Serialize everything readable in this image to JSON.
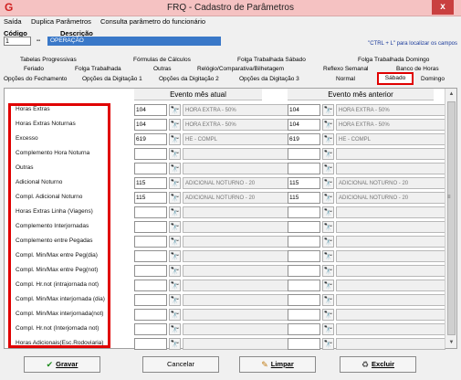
{
  "window": {
    "title": "FRQ - Cadastro de Parâmetros",
    "close": "x"
  },
  "menu": [
    "Saída",
    "Duplica Parâmetros",
    "Consulta parâmetro do funcionário"
  ],
  "fields": {
    "code_label": "Código",
    "desc_label": "Descrição",
    "code_value": "1",
    "desc_value": "OPERAÇÃO",
    "hint": "\"CTRL + L\" para localizar os campos"
  },
  "tabs": {
    "row1": [
      "Tabelas Progressivas",
      "Fórmulas de Cálculos",
      "Folga Trabalhada Sábado",
      "Folga Trabalhada Domingo"
    ],
    "row2": [
      "Feriado",
      "Folga Trabalhada",
      "Outras",
      "Relógio/Comparativa/Bilhetagem",
      "Reflexo Semanal",
      "Banco de Horas"
    ],
    "row3": [
      "Opções do Fechamento",
      "Opções da Digitação 1",
      "Opções da Digitação 2",
      "Opções da Digitação 3",
      "Normal",
      "Sábado",
      "Domingo"
    ],
    "selected": "Sábado"
  },
  "panel": {
    "header_current": "Evento mês atual",
    "header_previous": "Evento mês anterior",
    "rows": [
      {
        "label": "Horas Extras",
        "cur_code": "104",
        "cur_desc": "HORA EXTRA - 50%",
        "prev_code": "104",
        "prev_desc": "HORA EXTRA - 50%"
      },
      {
        "label": "Horas Extras Noturnas",
        "cur_code": "104",
        "cur_desc": "HORA EXTRA - 50%",
        "prev_code": "104",
        "prev_desc": "HORA EXTRA - 50%"
      },
      {
        "label": "Excesso",
        "cur_code": "619",
        "cur_desc": "HE - COMPL",
        "prev_code": "619",
        "prev_desc": "HE - COMPL"
      },
      {
        "label": "Complemento Hora Noturna",
        "cur_code": "",
        "cur_desc": "",
        "prev_code": "",
        "prev_desc": ""
      },
      {
        "label": "Outras",
        "cur_code": "",
        "cur_desc": "",
        "prev_code": "",
        "prev_desc": ""
      },
      {
        "label": "Adicional Noturno",
        "cur_code": "115",
        "cur_desc": "ADICIONAL NOTURNO - 20",
        "prev_code": "115",
        "prev_desc": "ADICIONAL NOTURNO - 20"
      },
      {
        "label": "Compl. Adicional Noturno",
        "cur_code": "115",
        "cur_desc": "ADICIONAL NOTURNO - 20",
        "prev_code": "115",
        "prev_desc": "ADICIONAL NOTURNO - 20"
      },
      {
        "label": "Horas Extras Linha (Viagens)",
        "cur_code": "",
        "cur_desc": "",
        "prev_code": "",
        "prev_desc": ""
      },
      {
        "label": "Complemento Interjornadas",
        "cur_code": "",
        "cur_desc": "",
        "prev_code": "",
        "prev_desc": ""
      },
      {
        "label": "Complemento entre Pegadas",
        "cur_code": "",
        "cur_desc": "",
        "prev_code": "",
        "prev_desc": ""
      },
      {
        "label": "Compl. Min/Max entre Peg(dia)",
        "cur_code": "",
        "cur_desc": "",
        "prev_code": "",
        "prev_desc": ""
      },
      {
        "label": "Compl. Min/Max entre Peg(not)",
        "cur_code": "",
        "cur_desc": "",
        "prev_code": "",
        "prev_desc": ""
      },
      {
        "label": "Compl. Hr.not (intrajornada not)",
        "cur_code": "",
        "cur_desc": "",
        "prev_code": "",
        "prev_desc": ""
      },
      {
        "label": "Compl. Min/Max interjornada (dia)",
        "cur_code": "",
        "cur_desc": "",
        "prev_code": "",
        "prev_desc": ""
      },
      {
        "label": "Compl. Min/Max interjornada(not)",
        "cur_code": "",
        "cur_desc": "",
        "prev_code": "",
        "prev_desc": ""
      },
      {
        "label": "Compl. Hr.not (Interjornada not)",
        "cur_code": "",
        "cur_desc": "",
        "prev_code": "",
        "prev_desc": ""
      },
      {
        "label": "Horas Adicionais(Esc.Rodoviaria)",
        "cur_code": "",
        "cur_desc": "",
        "prev_code": "",
        "prev_desc": ""
      }
    ]
  },
  "footer": {
    "save": "Gravar",
    "cancel": "Cancelar",
    "clear": "Limpar",
    "delete": "Excluir"
  }
}
